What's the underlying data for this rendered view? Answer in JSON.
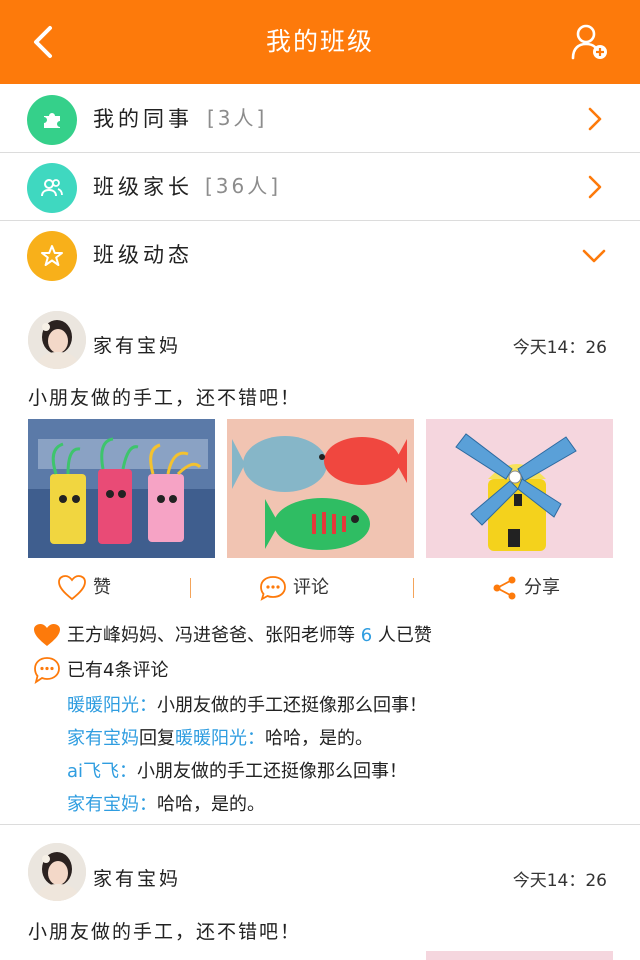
{
  "header": {
    "title": "我的班级",
    "back_icon": "chevron-left-icon",
    "add_icon": "add-user-icon"
  },
  "menu": [
    {
      "label": "我的同事",
      "count": "[3人]",
      "icon": "puzzle-icon",
      "color": "#35d08a",
      "arrow": "chevron-right-icon"
    },
    {
      "label": "班级家长",
      "count": "[36人]",
      "icon": "users-icon",
      "color": "#3fd8c0",
      "arrow": "chevron-right-icon"
    },
    {
      "label": "班级动态",
      "count": "",
      "icon": "star-badge-icon",
      "color": "#f8b01a",
      "arrow": "chevron-down-icon"
    }
  ],
  "posts": [
    {
      "author": "家有宝妈",
      "time": "今天14：26",
      "content": "小朋友做的手工，还不错吧！",
      "actions": {
        "like": "赞",
        "comment": "评论",
        "share": "分享"
      },
      "likes": {
        "prefix": "王方峰妈妈、冯进爸爸、张阳老师等",
        "count": "6",
        "suffix": "人已赞"
      },
      "comment_count": "已有4条评论",
      "comments": [
        {
          "name": "暖暖阳光：",
          "reply_word": "",
          "reply_to": "",
          "text": "小朋友做的手工还挺像那么回事！"
        },
        {
          "name": "家有宝妈",
          "reply_word": "回复",
          "reply_to": "暖暖阳光：",
          "text": "哈哈，是的。"
        },
        {
          "name": "ai飞飞：",
          "reply_word": "",
          "reply_to": "",
          "text": "小朋友做的手工还挺像那么回事！"
        },
        {
          "name": "家有宝妈：",
          "reply_word": "",
          "reply_to": "",
          "text": "哈哈，是的。"
        }
      ]
    },
    {
      "author": "家有宝妈",
      "time": "今天14：26",
      "content": "小朋友做的手工，还不错吧！"
    }
  ],
  "colors": {
    "brand": "#fd7a0b",
    "link": "#2f9de0"
  }
}
